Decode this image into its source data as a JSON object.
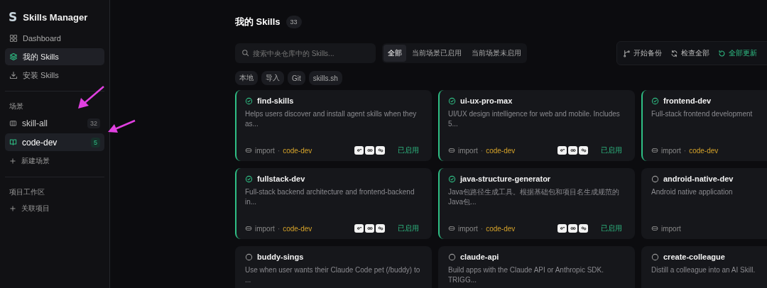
{
  "sidebar": {
    "logo": "S",
    "app_title": "Skills Manager",
    "nav": [
      {
        "label": "Dashboard",
        "kind": "grid",
        "selected": false
      },
      {
        "label": "我的 Skills",
        "kind": "layers",
        "selected": true
      },
      {
        "label": "安装 Skills",
        "kind": "download",
        "selected": false
      }
    ],
    "scenes_heading": "场景",
    "scenes": [
      {
        "name": "skill-all",
        "count": "32",
        "kind": "box",
        "selected": false
      },
      {
        "name": "code-dev",
        "count": "5",
        "kind": "book",
        "selected": true
      }
    ],
    "new_scene": "新建场景",
    "workspace_heading": "项目工作区",
    "link_project": "关联项目"
  },
  "main": {
    "title": "我的 Skills",
    "count": "33",
    "search": {
      "placeholder": "搜索中央仓库中的 Skills..."
    },
    "filters": [
      {
        "label": "全部",
        "selected": true
      },
      {
        "label": "当前场景已启用",
        "selected": false
      },
      {
        "label": "当前场景未启用",
        "selected": false
      }
    ],
    "actions": [
      {
        "label": "开始备份",
        "kind": "branch"
      },
      {
        "label": "检查全部",
        "kind": "refresh"
      },
      {
        "label": "全部更新",
        "kind": "update"
      }
    ],
    "sources": [
      "本地",
      "导入",
      "Git",
      "skills.sh"
    ],
    "skills": [
      {
        "name": "find-skills",
        "description": "Helps users discover and install agent skills when they as...",
        "enabled": true,
        "source": "import",
        "separator": "·",
        "scene": "code-dev",
        "agent_icons": true,
        "status": "已启用"
      },
      {
        "name": "ui-ux-pro-max",
        "description": "UI/UX design intelligence for web and mobile. Includes 5...",
        "enabled": true,
        "source": "import",
        "separator": "·",
        "scene": "code-dev",
        "agent_icons": true,
        "status": "已启用"
      },
      {
        "name": "frontend-dev",
        "description": "Full-stack frontend development",
        "enabled": true,
        "source": "import",
        "separator": "·",
        "scene": "code-dev",
        "agent_icons": false
      },
      {
        "name": "fullstack-dev",
        "description": "Full-stack backend architecture and frontend-backend in...",
        "enabled": true,
        "source": "import",
        "separator": "·",
        "scene": "code-dev",
        "agent_icons": true,
        "status": "已启用"
      },
      {
        "name": "java-structure-generator",
        "description": "Java包路径生成工具。根据基础包和项目名生成规范的Java包...",
        "enabled": true,
        "source": "import",
        "separator": "·",
        "scene": "code-dev",
        "agent_icons": true,
        "status": "已启用"
      },
      {
        "name": "android-native-dev",
        "description": "Android native application",
        "enabled": false,
        "source": "import",
        "agent_icons": false
      },
      {
        "name": "buddy-sings",
        "description": "Use when user wants their Claude Code pet (/buddy) to ...",
        "enabled": false
      },
      {
        "name": "claude-api",
        "description": "Build apps with the Claude API or Anthropic SDK. TRIGG...",
        "enabled": false
      },
      {
        "name": "create-colleague",
        "description": "Distill a colleague into an AI Skill.",
        "enabled": false
      }
    ]
  }
}
